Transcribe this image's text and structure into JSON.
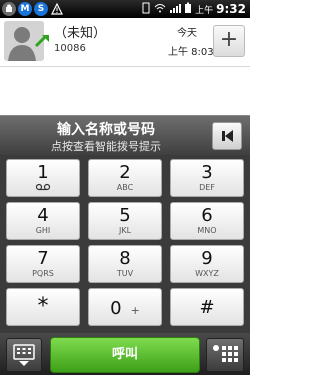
{
  "status_bar": {
    "icons": [
      "android-icon",
      "m-icon",
      "s-icon",
      "alert-icon"
    ],
    "am_pm": "上午",
    "time": "9:32"
  },
  "call_log": {
    "name": "（未知）",
    "number": "10086",
    "date": "今天",
    "time": "上午 8:03",
    "add_label": "+"
  },
  "entry": {
    "title": "输入名称或号码",
    "hint": "点按查看智能拨号提示"
  },
  "keypad": [
    {
      "digit": "1",
      "letters": "voicemail"
    },
    {
      "digit": "2",
      "letters": "ABC"
    },
    {
      "digit": "3",
      "letters": "DEF"
    },
    {
      "digit": "4",
      "letters": "GHI"
    },
    {
      "digit": "5",
      "letters": "JKL"
    },
    {
      "digit": "6",
      "letters": "MNO"
    },
    {
      "digit": "7",
      "letters": "PQRS"
    },
    {
      "digit": "8",
      "letters": "TUV"
    },
    {
      "digit": "9",
      "letters": "WXYZ"
    },
    {
      "digit": "*",
      "letters": ""
    },
    {
      "digit": "0",
      "letters": "+"
    },
    {
      "digit": "#",
      "letters": ""
    }
  ],
  "bottom": {
    "call_label": "呼叫"
  }
}
